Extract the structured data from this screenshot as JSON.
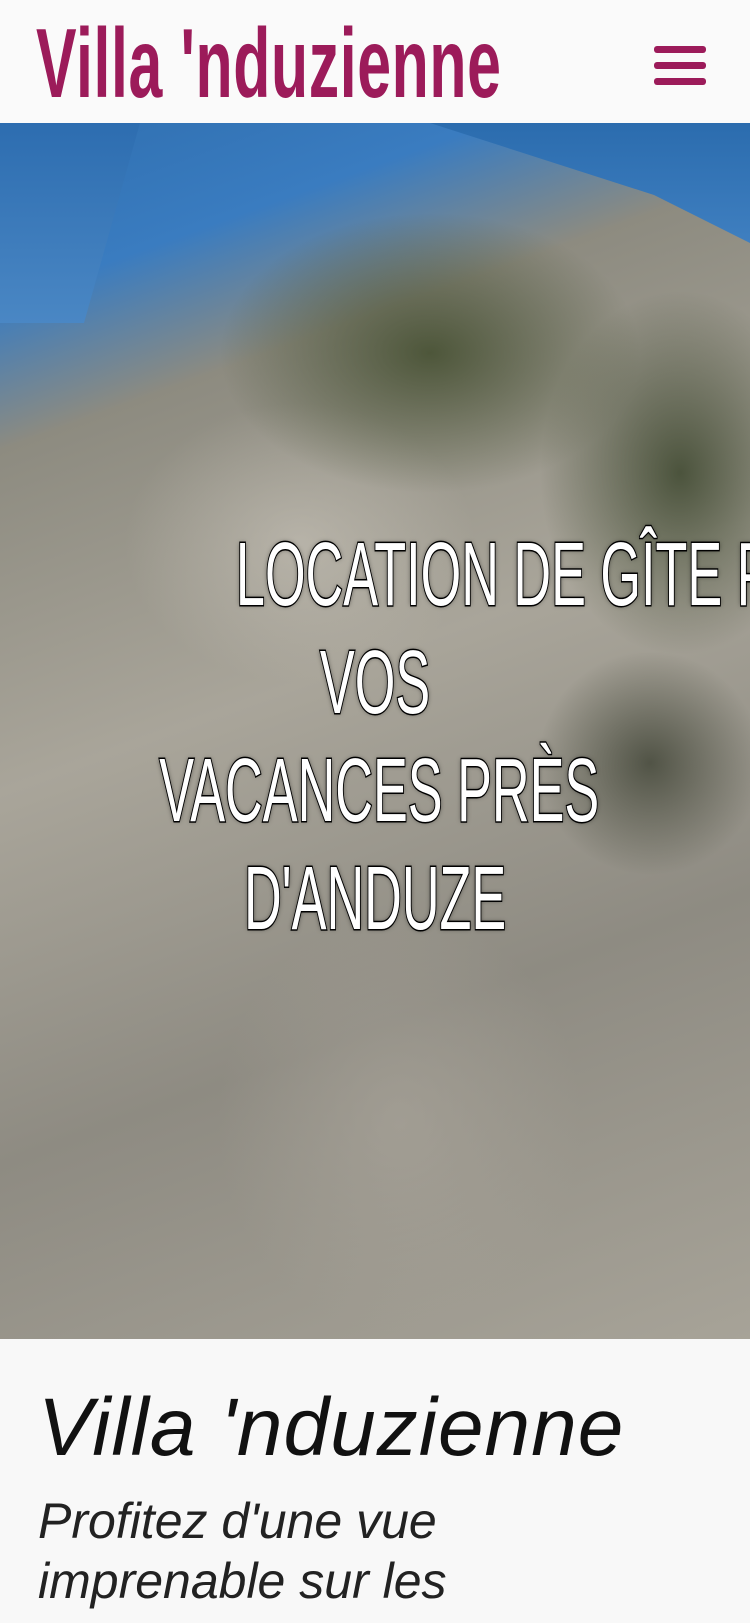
{
  "header": {
    "brand": "Villa 'nduzienne",
    "menu_icon": "hamburger-menu-icon",
    "brand_color": "#9c1b5a"
  },
  "hero": {
    "lines": [
      "LOCATION DE GÎTE POUR",
      "VOS",
      "VACANCES PRÈS",
      "D'ANDUZE"
    ]
  },
  "content": {
    "title": "Villa 'nduzienne",
    "subtitle": "Profitez d'une vue imprenable sur les"
  }
}
